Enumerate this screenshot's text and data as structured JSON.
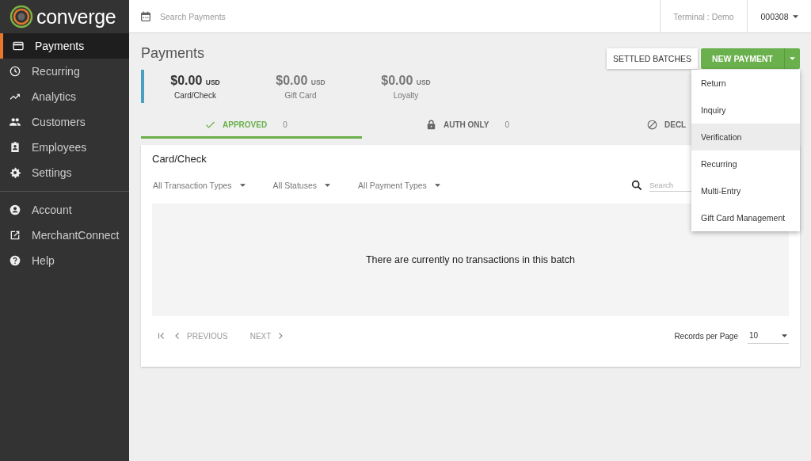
{
  "brand": {
    "name": "converge"
  },
  "sidebar": {
    "items": [
      {
        "label": "Payments",
        "kind": "card",
        "selected": true
      },
      {
        "label": "Recurring",
        "kind": "clock",
        "selected": false
      },
      {
        "label": "Analytics",
        "kind": "trend",
        "selected": false
      },
      {
        "label": "Customers",
        "kind": "people",
        "selected": false
      },
      {
        "label": "Employees",
        "kind": "badge",
        "selected": false
      },
      {
        "label": "Settings",
        "kind": "gear",
        "selected": false
      }
    ],
    "bottom_items": [
      {
        "label": "Account",
        "kind": "person",
        "selected": false
      },
      {
        "label": "MerchantConnect",
        "kind": "external",
        "selected": false
      },
      {
        "label": "Help",
        "kind": "help",
        "selected": false
      }
    ]
  },
  "topbar": {
    "search": {
      "placeholder": "Search Payments"
    },
    "terminal": "Terminal : Demo",
    "user": "000308"
  },
  "page": {
    "title": "Payments",
    "settled_button": "SETTLED BATCHES",
    "new_button": "NEW PAYMENT",
    "menu": [
      {
        "label": "Return",
        "selected": false
      },
      {
        "label": "Inquiry",
        "selected": false
      },
      {
        "label": "Verification",
        "selected": true
      },
      {
        "label": "Recurring",
        "selected": false
      },
      {
        "label": "Multi-Entry",
        "selected": false
      },
      {
        "label": "Gift Card Management",
        "selected": false
      }
    ]
  },
  "summary": [
    {
      "amount": "$0.00",
      "currency": "USD",
      "label": "Card/Check",
      "selected": true
    },
    {
      "amount": "$0.00",
      "currency": "USD",
      "label": "Gift Card",
      "selected": false
    },
    {
      "amount": "$0.00",
      "currency": "USD",
      "label": "Loyalty",
      "selected": false
    }
  ],
  "tabs": [
    {
      "label": "APPROVED",
      "count": "0",
      "kind": "check",
      "selected": true
    },
    {
      "label": "AUTH ONLY",
      "count": "0",
      "kind": "lock",
      "selected": false
    },
    {
      "label": "DECL",
      "kind": "block",
      "selected": false
    }
  ],
  "card": {
    "title": "Card/Check",
    "filters": [
      "All Transaction Types",
      "All Statuses",
      "All Payment Types"
    ],
    "search": {
      "placeholder": "Search"
    },
    "empty_message": "There are currently no transactions in this batch",
    "pagination": {
      "previous": "PREVIOUS",
      "next": "NEXT",
      "records_label": "Records per Page",
      "records_value": "10"
    }
  }
}
